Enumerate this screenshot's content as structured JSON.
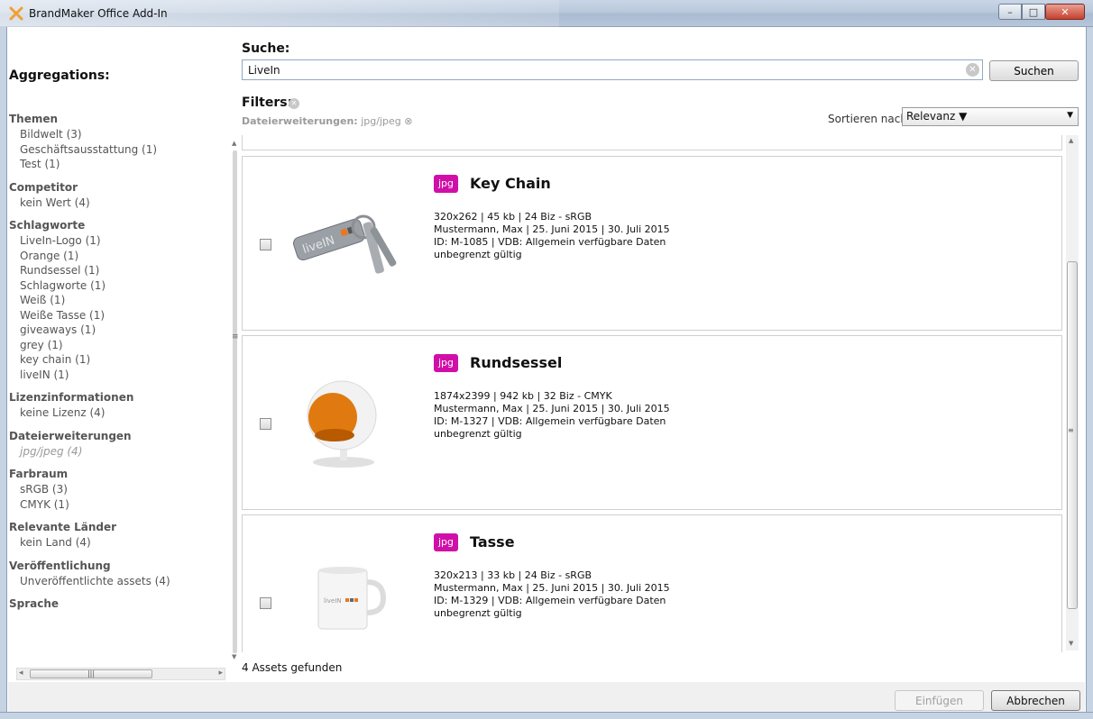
{
  "window": {
    "title": "BrandMaker Office Add-In",
    "controls": {
      "minimize": "–",
      "maximize": "□",
      "close": "✕"
    }
  },
  "search": {
    "label": "Suche:",
    "value": "LiveIn",
    "button_label": "Suchen",
    "clear_icon": "clear-icon"
  },
  "filters": {
    "label": "Filters:",
    "active": [
      {
        "name": "Dateierweiterungen:",
        "value": "jpg/jpeg"
      }
    ]
  },
  "sort": {
    "label": "Sortieren nach:",
    "selected": "Relevanz ▼"
  },
  "aggregations": {
    "heading": "Aggregations:",
    "groups": [
      {
        "title": "Themen",
        "items": [
          "Bildwelt (3)",
          "Geschäftsausstattung (1)",
          "Test (1)"
        ]
      },
      {
        "title": "Competitor",
        "items": [
          "kein Wert (4)"
        ]
      },
      {
        "title": "Schlagworte",
        "items": [
          "LiveIn-Logo (1)",
          "Orange (1)",
          "Rundsessel (1)",
          "Schlagworte (1)",
          "Weiß (1)",
          "Weiße Tasse (1)",
          "giveaways (1)",
          "grey (1)",
          "key chain (1)",
          "liveIN (1)"
        ]
      },
      {
        "title": "Lizenzinformationen",
        "items": [
          "keine Lizenz (4)"
        ]
      },
      {
        "title": "Dateierweiterungen",
        "items": [
          "jpg/jpeg (4)"
        ]
      },
      {
        "title": "Farbraum",
        "items": [
          "sRGB (3)",
          "CMYK (1)"
        ]
      },
      {
        "title": "Relevante Länder",
        "items": [
          "kein Land (4)"
        ]
      },
      {
        "title": "Veröffentlichung",
        "items": [
          "Unveröffentlichte assets (4)"
        ]
      },
      {
        "title": "Sprache",
        "items": []
      }
    ]
  },
  "results": [
    {
      "badge": "jpg",
      "title": "Key Chain",
      "meta": [
        "320x262 | 45 kb | 24 Biz - sRGB",
        "Mustermann, Max | 25. Juni 2015 | 30. Juli 2015",
        "ID: M-1085 | VDB: Allgemein verfügbare Daten",
        "unbegrenzt gültig"
      ]
    },
    {
      "badge": "jpg",
      "title": "Rundsessel",
      "meta": [
        "1874x2399 | 942 kb | 32 Biz - CMYK",
        "Mustermann, Max | 25. Juni 2015 | 30. Juli 2015",
        "ID: M-1327 | VDB: Allgemein verfügbare Daten",
        "unbegrenzt gültig"
      ]
    },
    {
      "badge": "jpg",
      "title": "Tasse",
      "meta": [
        "320x213 | 33 kb | 24 Biz - sRGB",
        "Mustermann, Max | 25. Juni 2015 | 30. Juli 2015",
        "ID: M-1329 | VDB: Allgemein verfügbare Daten",
        "unbegrenzt gültig"
      ]
    }
  ],
  "result_count": "4 Assets gefunden",
  "thumbnail_text": {
    "keychain_logo": "liveIN",
    "mug_logo": "liveIN"
  },
  "footer": {
    "insert_label": "Einfügen",
    "cancel_label": "Abbrechen"
  },
  "colors": {
    "badge": "#d10fa8",
    "accent_orange": "#e87722"
  }
}
